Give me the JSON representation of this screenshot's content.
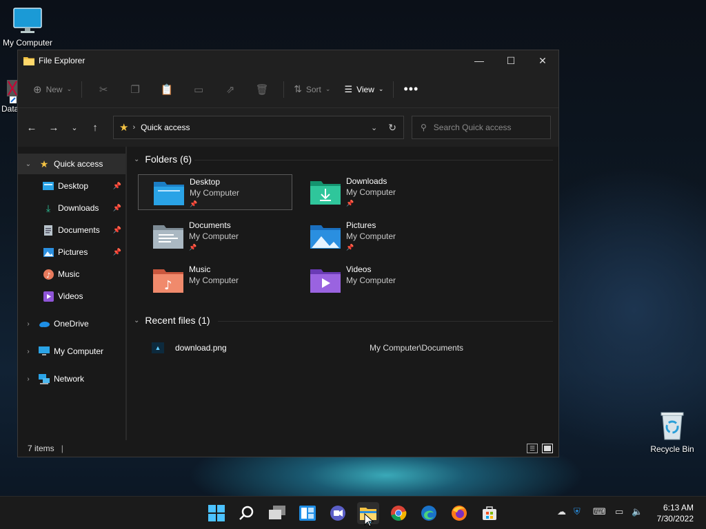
{
  "desktop": {
    "icons": [
      {
        "label": "My Computer"
      },
      {
        "label": "Data"
      },
      {
        "label": "Recycle Bin"
      }
    ]
  },
  "window": {
    "title": "File Explorer",
    "toolbar": {
      "new_label": "New",
      "sort_label": "Sort",
      "view_label": "View"
    },
    "address": {
      "location": "Quick access"
    },
    "search": {
      "placeholder": "Search Quick access"
    },
    "sidebar": {
      "items": [
        {
          "label": "Quick access",
          "icon": "star-icon"
        },
        {
          "label": "Desktop",
          "icon": "desktop-folder-icon"
        },
        {
          "label": "Downloads",
          "icon": "download-icon"
        },
        {
          "label": "Documents",
          "icon": "documents-icon"
        },
        {
          "label": "Pictures",
          "icon": "pictures-icon"
        },
        {
          "label": "Music",
          "icon": "music-icon"
        },
        {
          "label": "Videos",
          "icon": "videos-icon"
        },
        {
          "label": "OneDrive",
          "icon": "cloud-icon"
        },
        {
          "label": "My Computer",
          "icon": "computer-icon"
        },
        {
          "label": "Network",
          "icon": "network-icon"
        }
      ]
    },
    "folders_header": "Folders (6)",
    "folders": [
      {
        "name": "Desktop",
        "location": "My Computer",
        "pinned": true
      },
      {
        "name": "Downloads",
        "location": "My Computer",
        "pinned": true
      },
      {
        "name": "Documents",
        "location": "My Computer",
        "pinned": true
      },
      {
        "name": "Pictures",
        "location": "My Computer",
        "pinned": true
      },
      {
        "name": "Music",
        "location": "My Computer",
        "pinned": false
      },
      {
        "name": "Videos",
        "location": "My Computer",
        "pinned": false
      }
    ],
    "recent_header": "Recent files (1)",
    "recent_files": [
      {
        "name": "download.png",
        "path": "My Computer\\Documents"
      }
    ],
    "status": {
      "items": "7 items"
    }
  },
  "taskbar": {
    "clock": {
      "time": "6:13 AM",
      "date": "7/30/2022"
    }
  },
  "colors": {
    "accent": "#60cdff",
    "folder_yellow": "#f4c343"
  }
}
